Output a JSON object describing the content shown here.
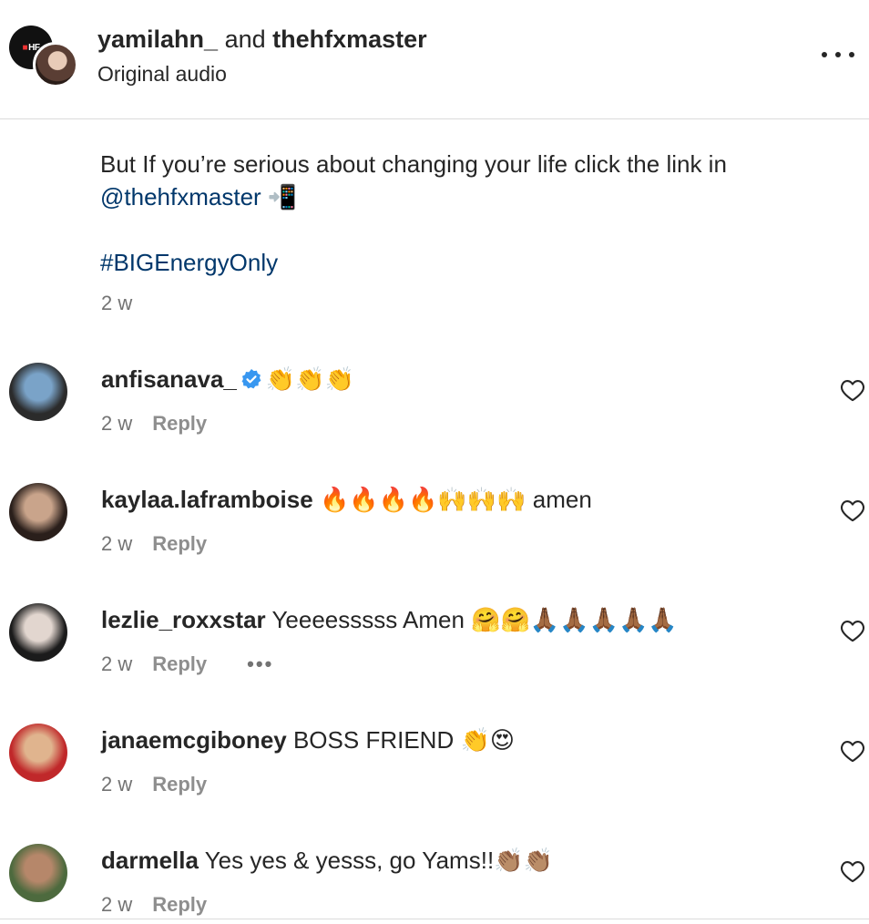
{
  "post": {
    "owner1": "yamilahn_",
    "connector": " and ",
    "owner2": "thehfxmaster",
    "audio": "Original audio",
    "caption_text": "But If you’re serious about changing your life click the link in",
    "caption_mention": "@thehfxmaster",
    "caption_emoji": "📲",
    "hashtag": "#BIGEnergyOnly",
    "time": "2 w",
    "logo_text": "HF"
  },
  "comments": [
    {
      "user": "anfisanava_",
      "verified": true,
      "text": "👏👏👏",
      "time": "2 w",
      "reply": "Reply",
      "avatar_colors": [
        "#7aa3c8",
        "#2b2b2b"
      ]
    },
    {
      "user": "kaylaa.laframboise",
      "verified": false,
      "text": "🔥🔥🔥🔥🙌🙌🙌 amen",
      "time": "2 w",
      "reply": "Reply",
      "avatar_colors": [
        "#c9a48b",
        "#2a1f1b"
      ]
    },
    {
      "user": "lezlie_roxxstar",
      "verified": false,
      "text": "Yeeeesssss Amen 🤗🤗🙏🏾🙏🏾🙏🏾🙏🏾🙏🏾",
      "time": "2 w",
      "reply": "Reply",
      "more": "•••",
      "avatar_colors": [
        "#e2d6cf",
        "#1b1b1b"
      ]
    },
    {
      "user": "janaemcgiboney",
      "verified": false,
      "text": "BOSS FRIEND 👏😍",
      "time": "2 w",
      "reply": "Reply",
      "avatar_colors": [
        "#e0b48e",
        "#c0282a"
      ]
    },
    {
      "user": "darmella",
      "verified": false,
      "text": "Yes yes & yesss, go Yams!!👏🏽👏🏽",
      "time": "2 w",
      "reply": "Reply",
      "avatar_colors": [
        "#b6876a",
        "#4d6a3e"
      ]
    }
  ]
}
